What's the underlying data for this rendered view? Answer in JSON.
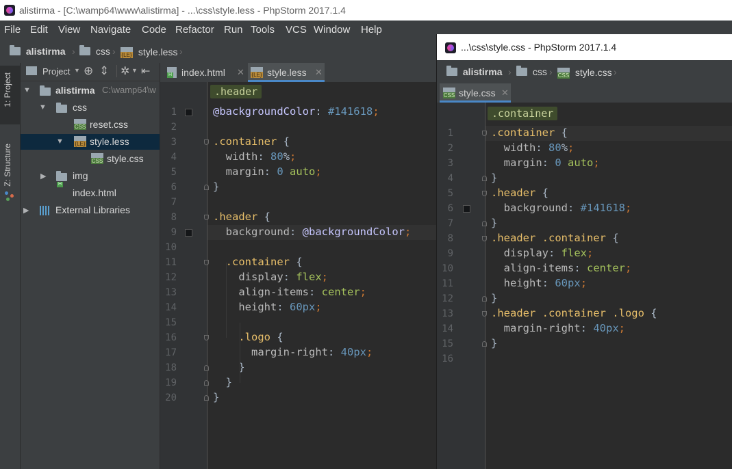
{
  "main_window": {
    "title": "alistirma - [C:\\wamp64\\www\\alistirma] - ...\\css\\style.less - PhpStorm 2017.1.4",
    "controls": {
      "minimize": "—",
      "maximize": "☐",
      "close": "✕"
    }
  },
  "menu": [
    "File",
    "Edit",
    "View",
    "Navigate",
    "Code",
    "Refactor",
    "Run",
    "Tools",
    "VCS",
    "Window",
    "Help"
  ],
  "navbar": {
    "project": "alistirma",
    "folder": "css",
    "file": "style.less"
  },
  "tool_strip": {
    "project_tab": "1: Project",
    "structure_tab": "Z: Structure"
  },
  "project_panel": {
    "view_label": "Project",
    "tree": [
      {
        "label": "alistirma",
        "path": "C:\\wamp64\\w",
        "type": "folder",
        "expanded": true
      },
      {
        "label": "css",
        "type": "folder",
        "expanded": true
      },
      {
        "label": "reset.css",
        "type": "css"
      },
      {
        "label": "style.less",
        "type": "less",
        "expanded": true,
        "selected": true
      },
      {
        "label": "style.css",
        "type": "css"
      },
      {
        "label": "img",
        "type": "folder",
        "expanded": false
      },
      {
        "label": "index.html",
        "type": "html"
      },
      {
        "label": "External Libraries",
        "type": "lib",
        "expanded": false
      }
    ]
  },
  "editor_left": {
    "tabs": [
      {
        "label": "index.html",
        "icon": "html-file-icon",
        "close": "✕"
      },
      {
        "label": "style.less",
        "icon": "less-file-icon",
        "close": "✕",
        "active": true
      }
    ],
    "breadcrumb": ".header",
    "line_numbers": [
      "1",
      "2",
      "3",
      "4",
      "5",
      "6",
      "7",
      "8",
      "9",
      "10",
      "11",
      "12",
      "13",
      "14",
      "15",
      "16",
      "17",
      "18",
      "19",
      "20"
    ],
    "lines": [
      "@backgroundColor: #141618;",
      "",
      ".container {",
      "  width: 80%;",
      "  margin: 0 auto;",
      "}",
      "",
      ".header {",
      "  background: @backgroundColor;",
      "",
      "  .container {",
      "    display: flex;",
      "    align-items: center;",
      "    height: 60px;",
      "",
      "    .logo {",
      "      margin-right: 40px;",
      "    }",
      "  }",
      "}"
    ],
    "color_markers_lines": [
      1,
      9
    ],
    "current_line": 9
  },
  "right_window": {
    "title": "...\\css\\style.css - PhpStorm 2017.1.4",
    "navbar": {
      "project": "alistirma",
      "folder": "css",
      "file": "style.css"
    },
    "tab": {
      "label": "style.css",
      "close": "✕"
    },
    "breadcrumb": ".container",
    "line_numbers": [
      "1",
      "2",
      "3",
      "4",
      "5",
      "6",
      "7",
      "8",
      "9",
      "10",
      "11",
      "12",
      "13",
      "14",
      "15",
      "16"
    ],
    "lines": [
      ".container {",
      "  width: 80%;",
      "  margin: 0 auto;",
      "}",
      ".header {",
      "  background: #141618;",
      "}",
      ".header .container {",
      "  display: flex;",
      "  align-items: center;",
      "  height: 60px;",
      "}",
      ".header .container .logo {",
      "  margin-right: 40px;",
      "}",
      ""
    ],
    "color_markers_lines": [
      6
    ],
    "current_line": 1
  },
  "colors": {
    "editor_bg": "#2b2b2b",
    "panel_bg": "#3c3f41",
    "selector": "#e8bf6a",
    "number": "#6897bb",
    "keyword_value": "#a5c25c",
    "variable": "#c7c7ff",
    "swatch": "#141618"
  }
}
